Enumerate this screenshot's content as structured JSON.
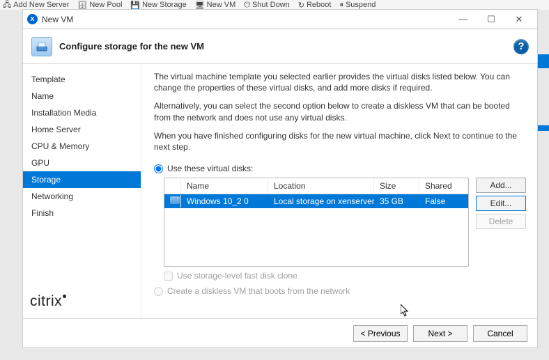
{
  "window": {
    "title": "New VM"
  },
  "bg_toolbar": {
    "items": [
      "Add New Server",
      "New Pool",
      "New Storage",
      "New VM",
      "Shut Down",
      "Reboot",
      "Suspend"
    ]
  },
  "header": {
    "title": "Configure storage for the new VM"
  },
  "sidebar": {
    "steps": [
      "Template",
      "Name",
      "Installation Media",
      "Home Server",
      "CPU & Memory",
      "GPU",
      "Storage",
      "Networking",
      "Finish"
    ],
    "active_index": 6
  },
  "content": {
    "para1": "The virtual machine template you selected earlier provides the virtual disks listed below. You can change the properties of these virtual disks, and add more disks if required.",
    "para2": "Alternatively, you can select the second option below to create a diskless VM that can be booted from the network and does not use any virtual disks.",
    "para3": "When you have finished configuring disks for the new virtual machine, click Next to continue to the next step.",
    "radio_use": "Use these virtual disks:",
    "table": {
      "headers": {
        "name": "Name",
        "location": "Location",
        "size": "Size",
        "shared": "Shared"
      },
      "rows": [
        {
          "name": "Windows 10_2 0",
          "location": "Local storage on xenserver",
          "size": "35 GB",
          "shared": "False"
        }
      ]
    },
    "buttons": {
      "add": "Add...",
      "edit": "Edit...",
      "delete": "Delete"
    },
    "fastclone": "Use storage-level fast disk clone",
    "radio_diskless": "Create a diskless VM that boots from the network"
  },
  "footer": {
    "prev": "< Previous",
    "next": "Next >",
    "cancel": "Cancel"
  },
  "brand": "citrix"
}
